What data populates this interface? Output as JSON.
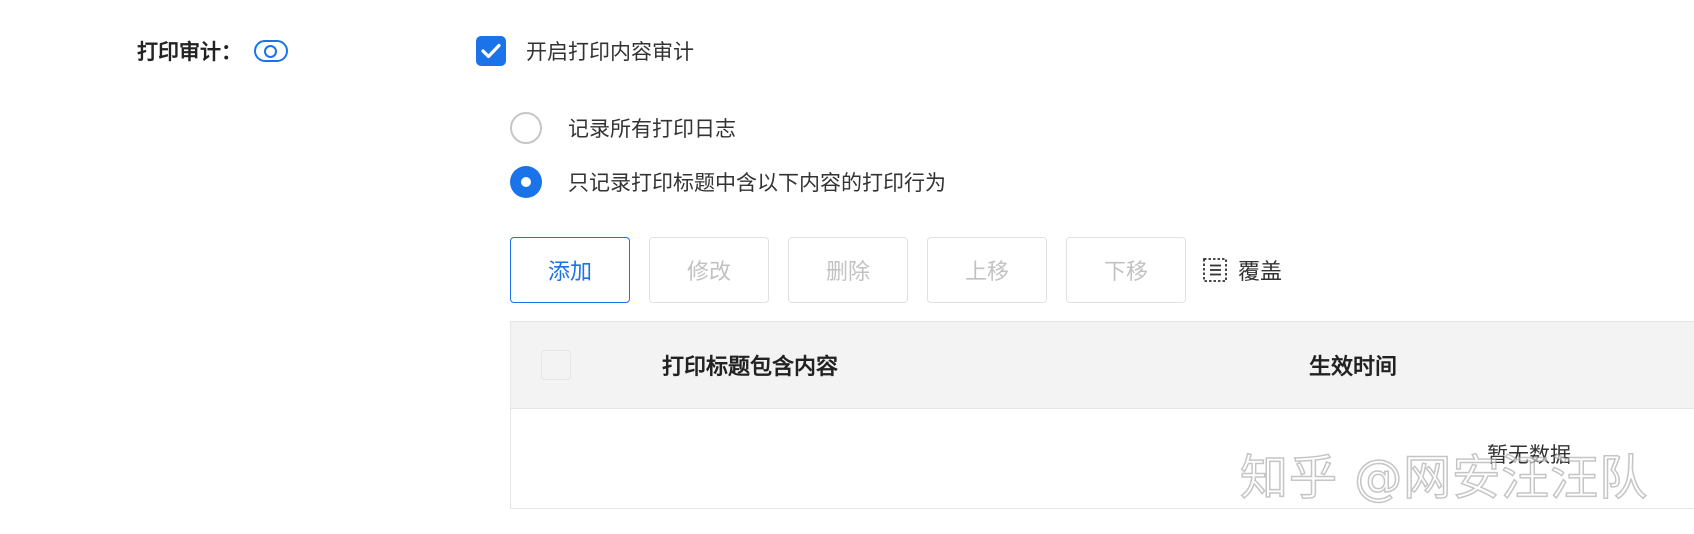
{
  "print_audit": {
    "label": "打印审计",
    "colon": "：",
    "toggle_icon": "toggle-icon",
    "enable_checkbox_checked": true,
    "enable_label": "开启打印内容审计",
    "options": [
      {
        "label": "记录所有打印日志",
        "selected": false
      },
      {
        "label": "只记录打印标题中含以下内容的打印行为",
        "selected": true
      }
    ]
  },
  "toolbar": {
    "add_label": "添加",
    "edit_label": "修改",
    "delete_label": "删除",
    "move_up_label": "上移",
    "move_down_label": "下移",
    "cover_icon": "list-box-icon",
    "cover_label": "覆盖"
  },
  "table": {
    "columns": [
      "打印标题包含内容",
      "生效时间"
    ],
    "empty_text": "暂无数据"
  },
  "watermark": "知乎 @网安汪汪队",
  "colors": {
    "accent": "#1a73e8",
    "disabled_text": "#c2c2c2",
    "header_bg": "#f3f3f3",
    "border": "#e6e6e6"
  }
}
